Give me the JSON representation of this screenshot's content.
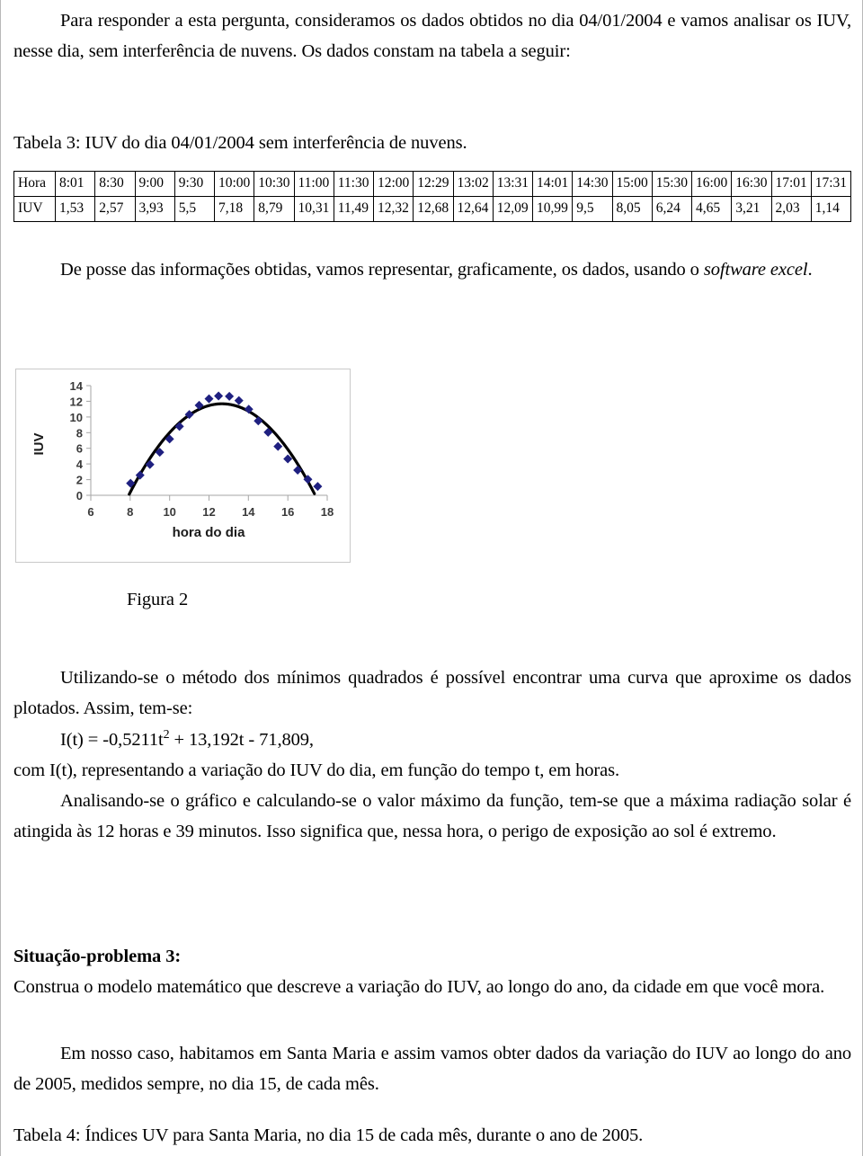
{
  "document": {
    "paragraphs": {
      "intro": "Para responder a esta pergunta, consideramos os dados obtidos no dia 04/01/2004 e vamos analisar os IUV, nesse dia, sem interferência de nuvens. Os dados constam na tabela a seguir:",
      "table3_caption": "Tabela 3: IUV do dia 04/01/2004 sem interferência de nuvens.",
      "after_table_1": "De posse das informações obtidas, vamos representar, graficamente, os dados, usando o ",
      "after_table_italic": "software excel",
      "after_table_2": ".",
      "figure2_caption": "Figura 2",
      "minimos_quadrados": "Utilizando-se o método dos mínimos quadrados é possível encontrar uma curva que aproxime os dados plotados. Assim, tem-se:",
      "equation_prefix": "I(t) = -0,5211t",
      "equation_exponent": "2",
      "equation_suffix": " + 13,192t - 71,809,",
      "com_it": "com I(t), representando a variação do IUV do dia, em função do tempo t, em horas.",
      "analisando": "Analisando-se o gráfico e calculando-se o valor máximo da função, tem-se que a máxima radiação solar é atingida às 12 horas e 39 minutos. Isso significa que, nessa hora, o perigo de exposição ao sol é extremo.",
      "situacao3_heading": "Situação-problema 3:",
      "situacao3_body": "Construa o modelo matemático que descreve a variação do IUV, ao longo do ano, da cidade em que você mora.",
      "santa_maria": "Em nosso caso, habitamos em Santa Maria e assim vamos obter dados da variação do IUV ao longo do ano de 2005, medidos sempre, no dia 15, de cada mês.",
      "table4_caption": "Tabela 4: Índices UV para Santa Maria, no dia 15 de cada mês, durante o ano de 2005."
    }
  },
  "table3": {
    "row_labels": [
      "Hora",
      "IUV"
    ],
    "hours": [
      "8:01",
      "8:30",
      "9:00",
      "9:30",
      "10:00",
      "10:30",
      "11:00",
      "11:30",
      "12:00",
      "12:29",
      "13:02",
      "13:31",
      "14:01",
      "14:30",
      "15:00",
      "15:30",
      "16:00",
      "16:30",
      "17:01",
      "17:31"
    ],
    "iuv": [
      "1,53",
      "2,57",
      "3,93",
      "5,5",
      "7,18",
      "8,79",
      "10,31",
      "11,49",
      "12,32",
      "12,68",
      "12,64",
      "12,09",
      "10,99",
      "9,5",
      "8,05",
      "6,24",
      "4,65",
      "3,21",
      "2,03",
      "1,14"
    ]
  },
  "chart_data": {
    "type": "scatter",
    "title": "",
    "xlabel": "hora do dia",
    "ylabel": "IUV",
    "xlim": [
      6,
      18
    ],
    "ylim": [
      0,
      14
    ],
    "xticks": [
      6,
      8,
      10,
      12,
      14,
      16,
      18
    ],
    "yticks": [
      0,
      2,
      4,
      6,
      8,
      10,
      12,
      14
    ],
    "grid": false,
    "legend": false,
    "marker_color": "#1f2080",
    "marker_shape": "diamond",
    "trendline_color": "#000000",
    "x": [
      8.017,
      8.5,
      9.0,
      9.5,
      10.0,
      10.5,
      11.0,
      11.5,
      12.0,
      12.483,
      13.033,
      13.517,
      14.017,
      14.5,
      15.0,
      15.5,
      16.0,
      16.5,
      17.017,
      17.517
    ],
    "y": [
      1.53,
      2.57,
      3.93,
      5.5,
      7.18,
      8.79,
      10.31,
      11.49,
      12.32,
      12.68,
      12.64,
      12.09,
      10.99,
      9.5,
      8.05,
      6.24,
      4.65,
      3.21,
      2.03,
      1.14
    ],
    "trendline": {
      "type": "quadratic",
      "equation": "I(t) = -0,5211t^2 + 13,192t - 71,809",
      "a": -0.5211,
      "b": 13.192,
      "c": -71.809
    }
  }
}
